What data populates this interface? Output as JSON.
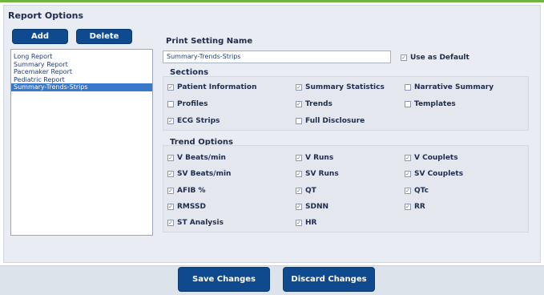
{
  "panel": {
    "title": "Report Options"
  },
  "buttons": {
    "add": "Add",
    "delete": "Delete",
    "save": "Save Changes",
    "discard": "Discard Changes"
  },
  "reports": {
    "items": [
      "Long Report",
      "Summary Report",
      "Pacemaker Report",
      "Pediatric Report",
      "Summary-Trends-Strips"
    ],
    "selected": "Summary-Trends-Strips"
  },
  "print_setting": {
    "label": "Print Setting Name",
    "value": "Summary-Trends-Strips",
    "use_as_default": {
      "label": "Use as Default",
      "checked": true
    }
  },
  "sections": {
    "title": "Sections",
    "items": [
      {
        "label": "Patient Information",
        "checked": true
      },
      {
        "label": "Summary Statistics",
        "checked": true
      },
      {
        "label": "Narrative Summary",
        "checked": false
      },
      {
        "label": "Profiles",
        "checked": false
      },
      {
        "label": "Trends",
        "checked": true
      },
      {
        "label": "Templates",
        "checked": false
      },
      {
        "label": "ECG Strips",
        "checked": true
      },
      {
        "label": "Full Disclosure",
        "checked": false
      }
    ]
  },
  "trend_options": {
    "title": "Trend Options",
    "items": [
      {
        "label": "V Beats/min",
        "checked": true
      },
      {
        "label": "V Runs",
        "checked": true
      },
      {
        "label": "V Couplets",
        "checked": true
      },
      {
        "label": "SV Beats/min",
        "checked": true
      },
      {
        "label": "SV Runs",
        "checked": true
      },
      {
        "label": "SV Couplets",
        "checked": true
      },
      {
        "label": "AFIB %",
        "checked": true
      },
      {
        "label": "QT",
        "checked": true
      },
      {
        "label": "QTc",
        "checked": true
      },
      {
        "label": "RMSSD",
        "checked": true
      },
      {
        "label": "SDNN",
        "checked": true
      },
      {
        "label": "RR",
        "checked": true
      },
      {
        "label": "ST Analysis",
        "checked": true
      },
      {
        "label": "HR",
        "checked": true
      }
    ]
  },
  "colors": {
    "accent": "#0f4a8f",
    "selection": "#3a78c9",
    "topline": "#6fb43f"
  }
}
